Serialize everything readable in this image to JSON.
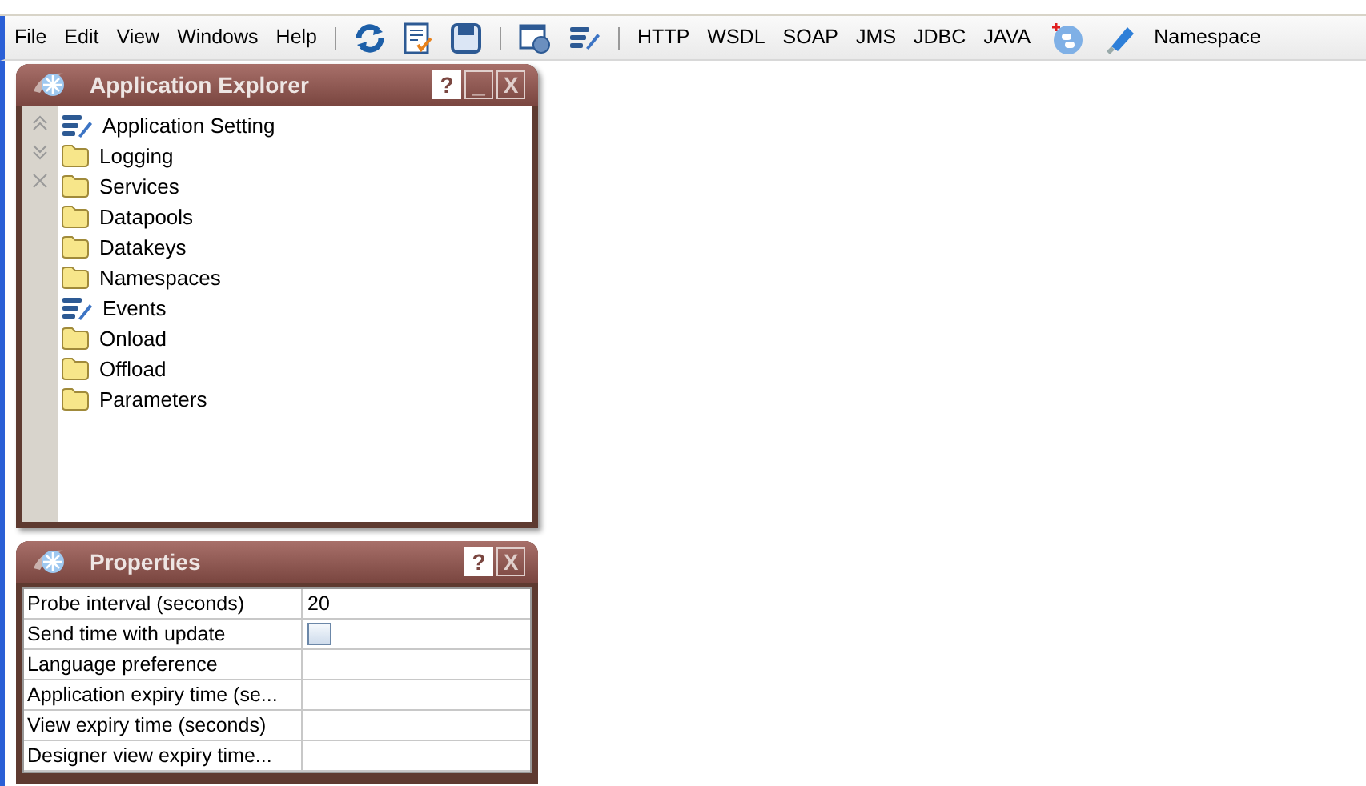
{
  "menu": [
    "File",
    "Edit",
    "View",
    "Windows",
    "Help"
  ],
  "toolbar": [
    {
      "kind": "separator"
    },
    {
      "kind": "icon"
    },
    {
      "kind": "icon"
    },
    {
      "kind": "icon"
    },
    {
      "kind": "separator"
    },
    {
      "kind": "icon"
    },
    {
      "kind": "icon"
    },
    {
      "kind": "separator"
    },
    {
      "kind": "text",
      "label": "HTTP"
    },
    {
      "kind": "text",
      "label": "WSDL"
    },
    {
      "kind": "text",
      "label": "SOAP"
    },
    {
      "kind": "text",
      "label": "JMS"
    },
    {
      "kind": "text",
      "label": "JDBC"
    },
    {
      "kind": "text",
      "label": "JAVA"
    },
    {
      "kind": "icon"
    },
    {
      "kind": "icon"
    },
    {
      "kind": "text",
      "label": "Namespace"
    }
  ],
  "explorer": {
    "title": "Application Explorer",
    "title_buttons": [
      "?",
      "_",
      "X"
    ],
    "items": [
      {
        "kind": "config",
        "label": "Application Setting"
      },
      {
        "kind": "folder",
        "label": "Logging"
      },
      {
        "kind": "folder",
        "label": "Services"
      },
      {
        "kind": "folder",
        "label": "Datapools"
      },
      {
        "kind": "folder",
        "label": "Datakeys"
      },
      {
        "kind": "folder",
        "label": "Namespaces"
      },
      {
        "kind": "config",
        "label": "Events"
      },
      {
        "kind": "folder",
        "label": "Onload"
      },
      {
        "kind": "folder",
        "label": "Offload"
      },
      {
        "kind": "folder",
        "label": "Parameters"
      }
    ]
  },
  "properties": {
    "title": "Properties",
    "title_buttons": [
      "?",
      "X"
    ],
    "rows": [
      {
        "kind": "text",
        "name": "Probe interval (seconds)",
        "value": "20"
      },
      {
        "kind": "checkbox",
        "name": "Send time with update",
        "checked": false
      },
      {
        "kind": "text",
        "name": "Language preference"
      },
      {
        "kind": "text",
        "name": "Application expiry time (se..."
      },
      {
        "kind": "text",
        "name": "View expiry time (seconds)"
      },
      {
        "kind": "text",
        "name": "Designer view expiry time..."
      }
    ]
  }
}
